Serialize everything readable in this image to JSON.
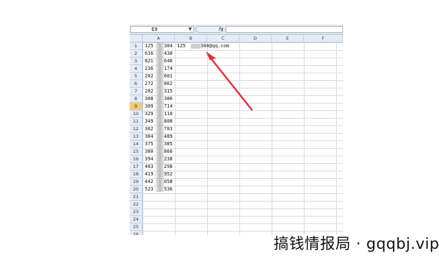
{
  "formula_bar": {
    "name_box": "E9",
    "fx_label": "fx"
  },
  "columns": [
    "A",
    "B",
    "C",
    "D",
    "E",
    "F"
  ],
  "rows": [
    "1",
    "2",
    "3",
    "4",
    "5",
    "6",
    "7",
    "8",
    "9",
    "10",
    "11",
    "12",
    "13",
    "14",
    "15",
    "16",
    "17",
    "18",
    "19",
    "20",
    "21",
    "22",
    "23",
    "24",
    "25",
    "26"
  ],
  "active_row": "9",
  "column_a": [
    {
      "left": "125",
      "right": "304"
    },
    {
      "left": "616",
      "right": "430"
    },
    {
      "left": "821",
      "right": "646"
    },
    {
      "left": "236",
      "right": "174"
    },
    {
      "left": "262",
      "right": "601"
    },
    {
      "left": "272",
      "right": "862"
    },
    {
      "left": "282",
      "right": "315"
    },
    {
      "left": "308",
      "right": "386"
    },
    {
      "left": "309",
      "right": "714"
    },
    {
      "left": "329",
      "right": "110"
    },
    {
      "left": "349",
      "right": "808"
    },
    {
      "left": "362",
      "right": "703"
    },
    {
      "left": "364",
      "right": "489"
    },
    {
      "left": "375",
      "right": "385"
    },
    {
      "left": "380",
      "right": "866"
    },
    {
      "left": "394",
      "right": "238"
    },
    {
      "left": "403",
      "right": "298"
    },
    {
      "left": "419",
      "right": "952"
    },
    {
      "left": "442",
      "right": "058"
    },
    {
      "left": "523",
      "right": "536"
    }
  ],
  "b1": {
    "left": "125",
    "right": "304@qq.com"
  },
  "watermark": "搞钱情报局 · gqqbj.vip",
  "colors": {
    "header_bg": "#e4ecf7",
    "active_row": "#f5c878",
    "arrow": "#d9363e",
    "grid": "#d4dae3"
  }
}
